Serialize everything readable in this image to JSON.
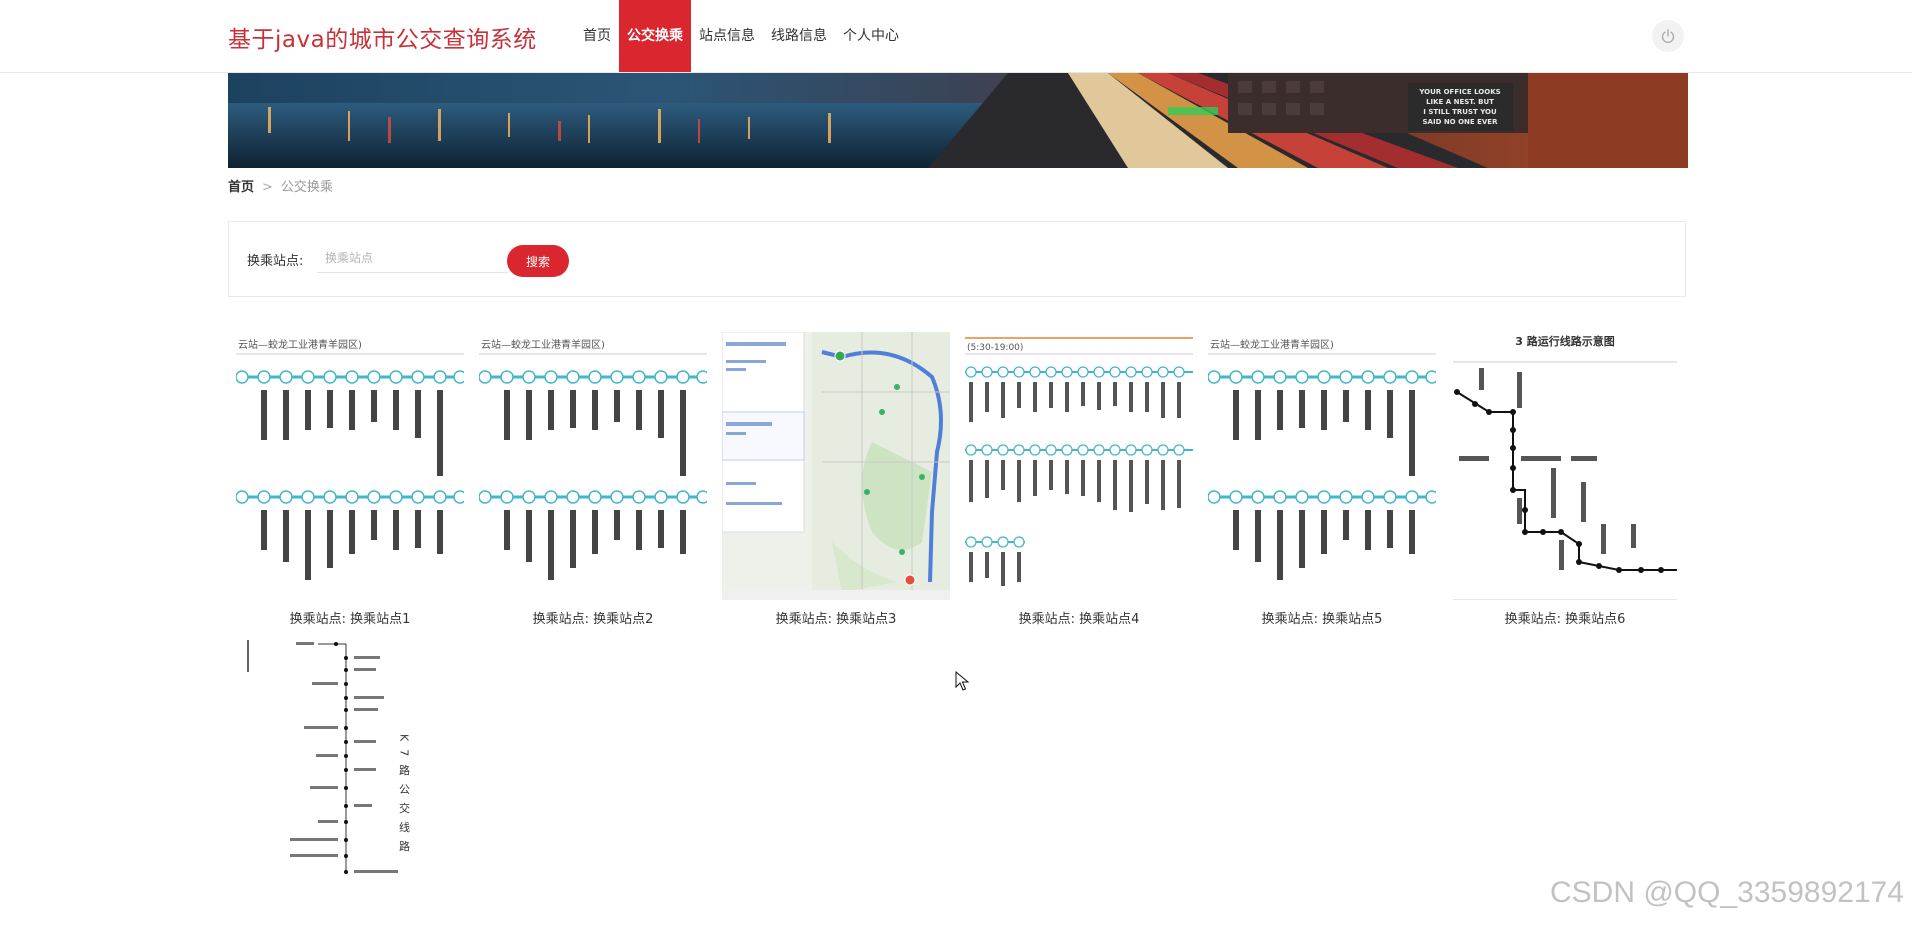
{
  "header": {
    "site_title": "基于java的城市公交查询系统",
    "nav": [
      {
        "label": "首页"
      },
      {
        "label": "公交换乘"
      },
      {
        "label": "站点信息"
      },
      {
        "label": "线路信息"
      },
      {
        "label": "个人中心"
      }
    ],
    "active_nav": "公交换乘",
    "power_icon": "power-icon"
  },
  "banner": {
    "billboard_lines": [
      "YOUR OFFICE LOOKS",
      "LIKE A NEST. BUT",
      "I STILL TRUST YOU",
      "SAID NO ONE EVER"
    ]
  },
  "breadcrumb": {
    "home": "首页",
    "separator": ">",
    "current": "公交换乘"
  },
  "search": {
    "label": "换乘站点:",
    "placeholder": "换乘站点",
    "value": "",
    "button": "搜索"
  },
  "cards": [
    {
      "caption": "换乘站点:  换乘站点1",
      "header_text": "云站—蛟龙工业港青羊园区)",
      "image_kind": "route-strip"
    },
    {
      "caption": "换乘站点:  换乘站点2",
      "header_text": "云站—蛟龙工业港青羊园区)",
      "image_kind": "route-strip"
    },
    {
      "caption": "换乘站点:  换乘站点3",
      "image_kind": "map"
    },
    {
      "caption": "换乘站点:  换乘站点4",
      "header_text": "(5:30-19:00)",
      "image_kind": "route-strip"
    },
    {
      "caption": "换乘站点:  换乘站点5",
      "header_text": "云站—蛟龙工业港青羊园区)",
      "image_kind": "route-strip"
    },
    {
      "caption": "换乘站点:  换乘站点6",
      "header_text": "3 路运行线路示意图",
      "image_kind": "line-diagram"
    },
    {
      "caption": "",
      "header_text": "K7路公交线路",
      "image_kind": "vertical-route"
    }
  ],
  "watermark": "CSDN @QQ_3359892174",
  "colors": {
    "accent": "#d9262f",
    "title": "#c8313a",
    "route_teal": "#43b7c9"
  }
}
